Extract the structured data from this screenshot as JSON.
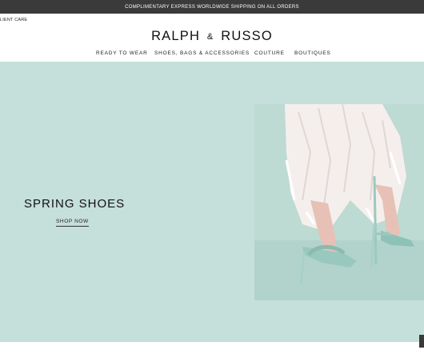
{
  "promo": {
    "text": "COMPLIMENTARY EXPRESS WORLDWIDE SHIPPING ON ALL ORDERS"
  },
  "header": {
    "client_care": "LIENT CARE",
    "logo_left": "RALPH",
    "logo_amp": "&",
    "logo_right": "RUSSO"
  },
  "nav": {
    "items": [
      {
        "label": "READY TO WEAR"
      },
      {
        "label": "SHOES, BAGS & ACCESSORIES"
      },
      {
        "label": "COUTURE"
      },
      {
        "label": "BOUTIQUES"
      }
    ]
  },
  "hero": {
    "title": "SPRING SHOES",
    "link": "SHOP NOW"
  },
  "colors": {
    "promo_bg": "#3a3a3a",
    "hero_bg": "#c5dfda",
    "text": "#111111"
  }
}
